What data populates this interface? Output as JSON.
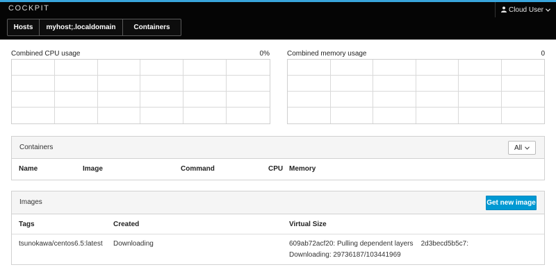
{
  "app": {
    "brand": "COCKPIT",
    "user": {
      "name": "Cloud User",
      "user_icon": "user-icon",
      "chevron": "chevron-down-icon"
    }
  },
  "breadcrumb": [
    "Hosts",
    "myhost;.localdomain",
    "Containers"
  ],
  "cpu": {
    "label": "Combined CPU usage",
    "value": "0%"
  },
  "memory": {
    "label": "Combined memory usage",
    "value": "0"
  },
  "containers": {
    "title": "Containers",
    "filter": "All",
    "columns": {
      "name": "Name",
      "image": "Image",
      "command": "Command",
      "cpu": "CPU",
      "memory": "Memory"
    }
  },
  "images": {
    "title": "Images",
    "get_button": "Get new image",
    "columns": {
      "tags": "Tags",
      "created": "Created",
      "size": "Virtual Size"
    },
    "rows": [
      {
        "tags": "tsunokawa/centos6.5:latest",
        "created": "Downloading",
        "size_line1": "609ab72acf20: Pulling dependent layers    2d3becd5b5c7:",
        "size_line2": "Downloading: 29736187/103441969"
      }
    ]
  },
  "colors": {
    "accent": "#39a5dc",
    "topbar": "#050505",
    "primary": "#0099d3"
  }
}
